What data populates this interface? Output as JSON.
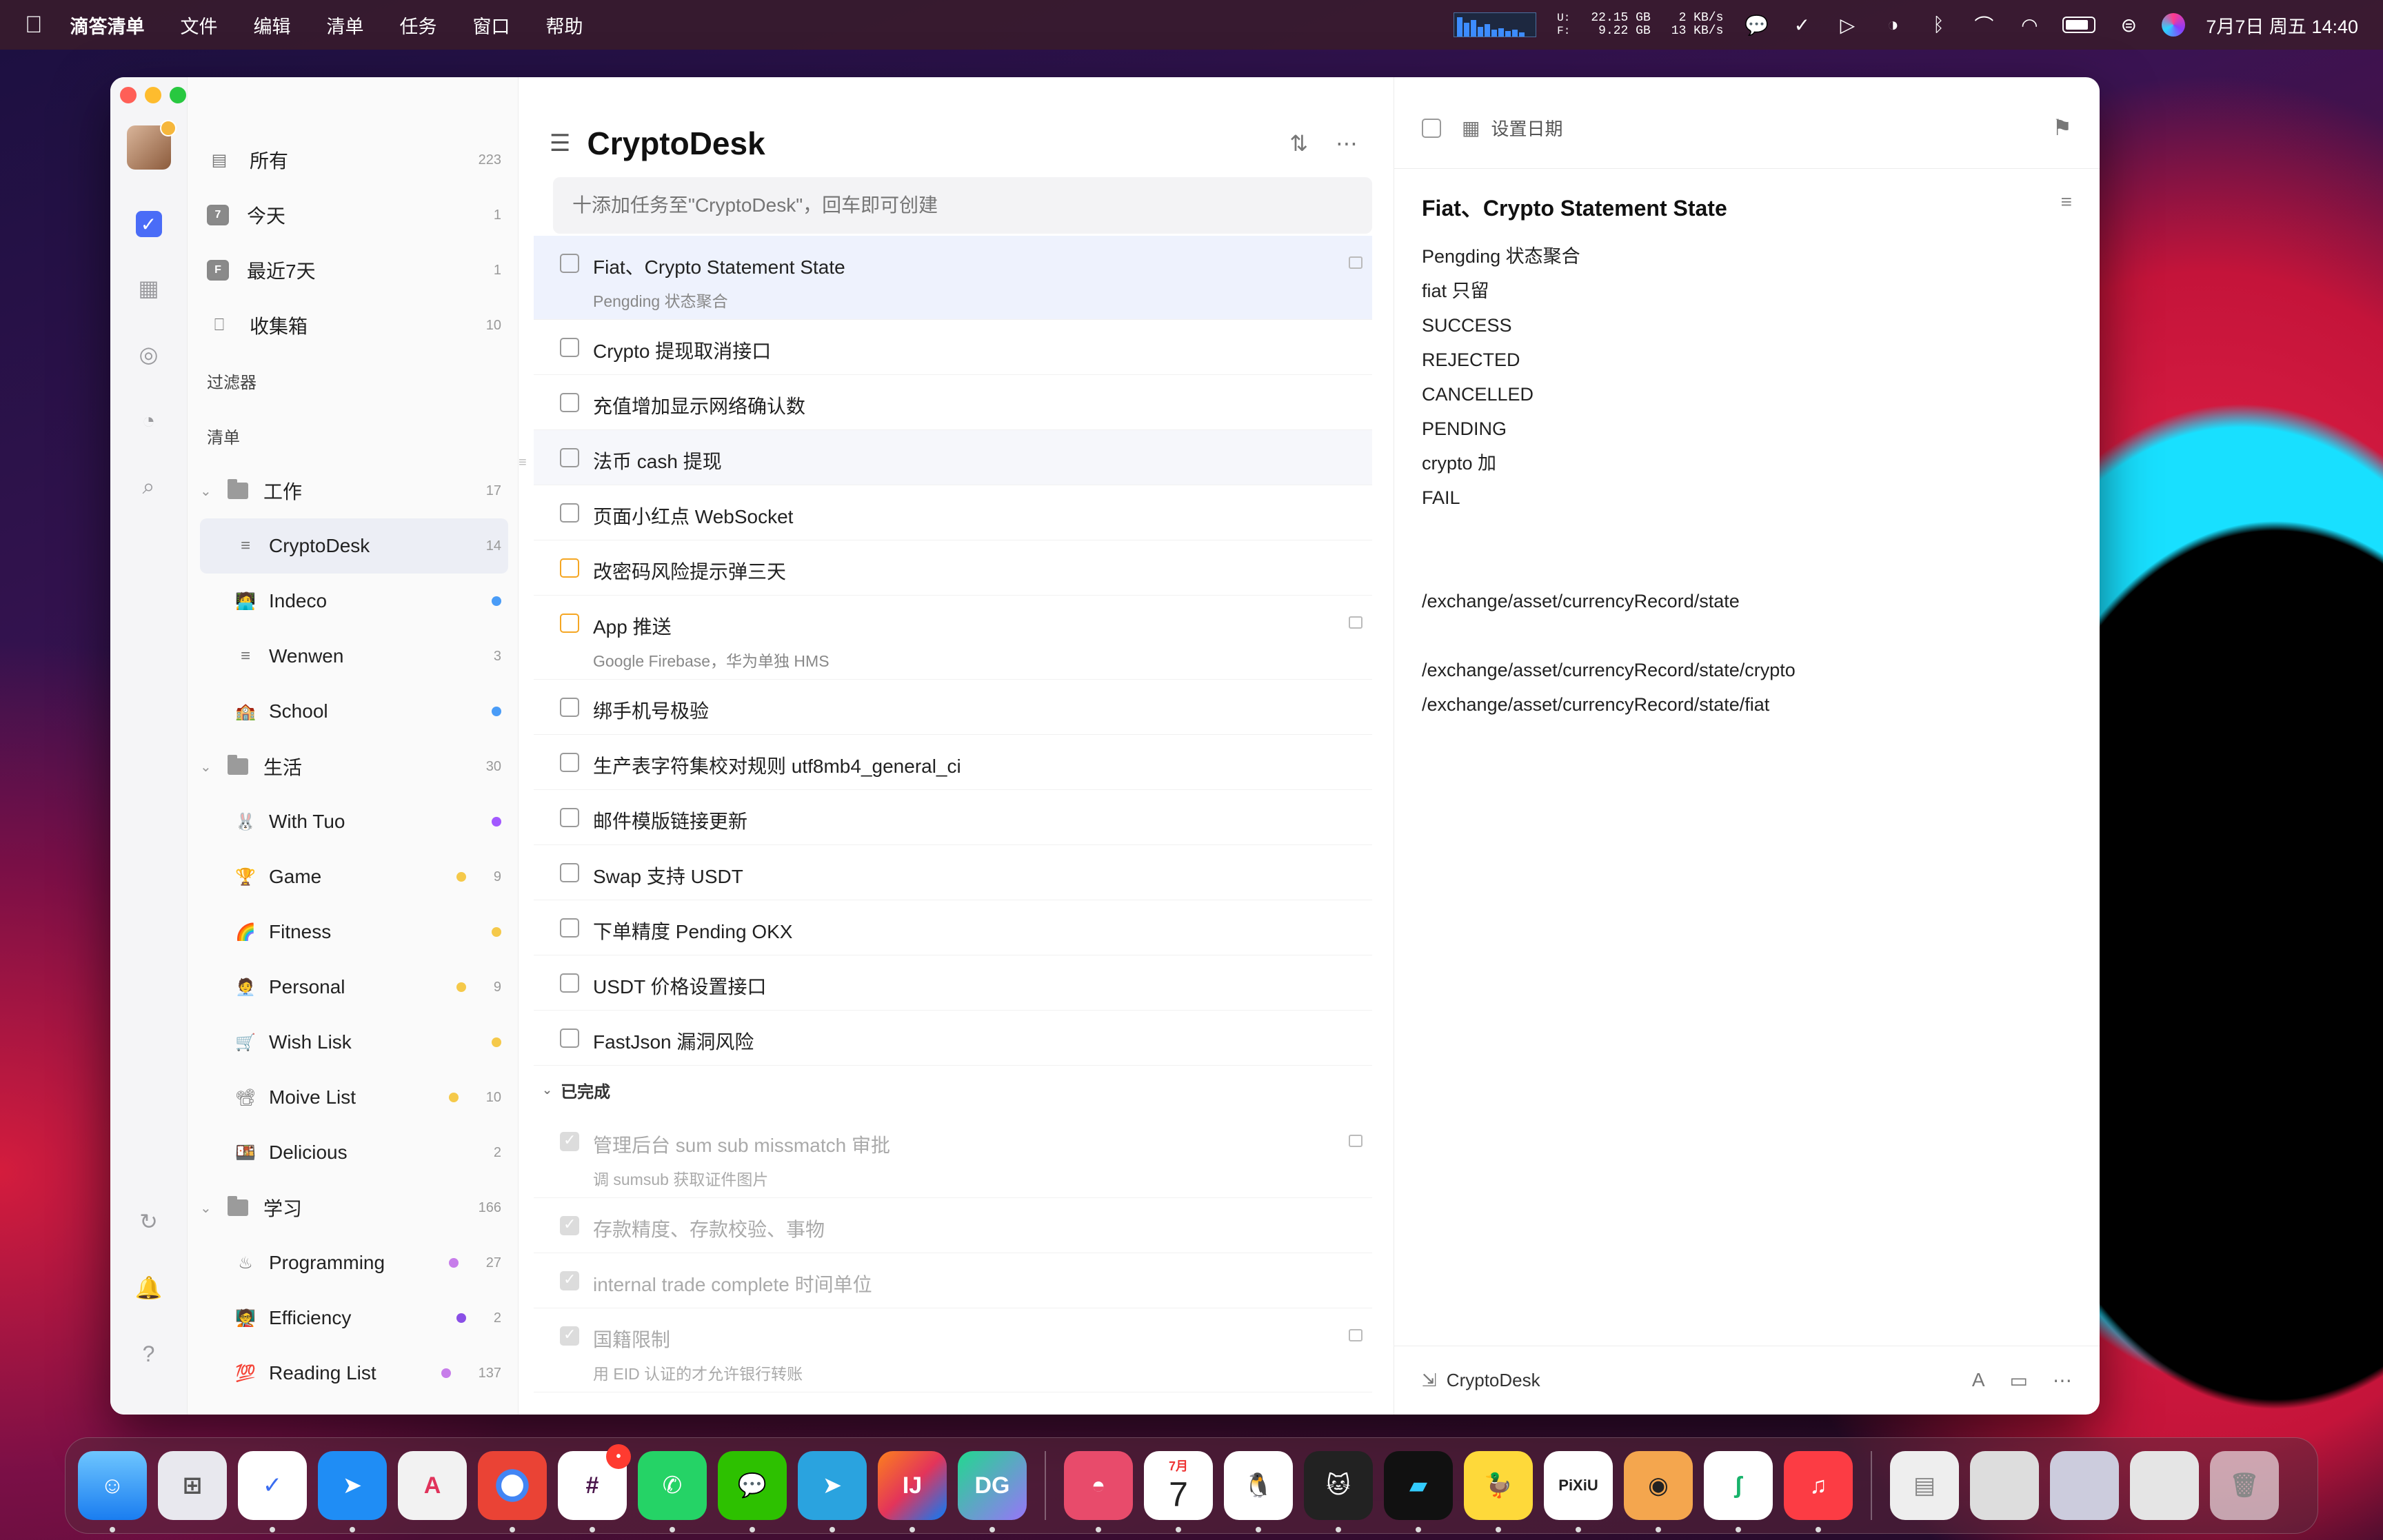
{
  "menubar": {
    "app_name": "滴答清单",
    "menus": [
      "文件",
      "编辑",
      "清单",
      "任务",
      "窗口",
      "帮助"
    ],
    "disk_labels": "U:\nF:",
    "disk_used": "22.15 GB",
    "disk_free": "9.22 GB",
    "net_up": "2 KB/s",
    "net_down": "13 KB/s",
    "datetime": "7月7日 周五  14:40"
  },
  "sidebar": {
    "smart_lists": [
      {
        "label": "所有",
        "count": "223"
      },
      {
        "label": "今天",
        "count": "1"
      },
      {
        "label": "最近7天",
        "count": "1"
      },
      {
        "label": "收集箱",
        "count": "10"
      }
    ],
    "filters_label": "过滤器",
    "lists_label": "清单",
    "folders": [
      {
        "label": "工作",
        "count": "17",
        "items": [
          {
            "label": "CryptoDesk",
            "count": "14",
            "icon": "≡"
          },
          {
            "label": "Indeco",
            "count": "",
            "icon": "🧑‍💻",
            "dot": "#4a9cf7"
          },
          {
            "label": "Wenwen",
            "count": "3",
            "icon": "≡"
          },
          {
            "label": "School",
            "count": "",
            "icon": "🏫",
            "dot": "#4a9cf7"
          }
        ]
      },
      {
        "label": "生活",
        "count": "30",
        "items": [
          {
            "label": "With Tuo",
            "count": "",
            "icon": "🐰",
            "dot": "#a259ff"
          },
          {
            "label": "Game",
            "count": "9",
            "icon": "🏆",
            "dot": "#f5c94a"
          },
          {
            "label": "Fitness",
            "count": "",
            "icon": "🌈",
            "dot": "#f5c94a"
          },
          {
            "label": "Personal",
            "count": "9",
            "icon": "🧑‍💼",
            "dot": "#f5c94a"
          },
          {
            "label": "Wish Lisk",
            "count": "",
            "icon": "🛒",
            "dot": "#f5c94a"
          },
          {
            "label": "Moive List",
            "count": "10",
            "icon": "📽",
            "dot": "#f5c94a"
          },
          {
            "label": "Delicious",
            "count": "2",
            "icon": "🍱"
          }
        ]
      },
      {
        "label": "学习",
        "count": "166",
        "items": [
          {
            "label": "Programming",
            "count": "27",
            "icon": "♨",
            "dot": "#c77dea"
          },
          {
            "label": "Efficiency",
            "count": "2",
            "icon": "🧑‍🏫",
            "dot": "#8a4fe6"
          },
          {
            "label": "Reading List",
            "count": "137",
            "icon": "💯",
            "dot": "#c77dea"
          }
        ]
      }
    ]
  },
  "tasklist": {
    "title": "CryptoDesk",
    "add_placeholder": "十添加任务至\"CryptoDesk\"，回车即可创建",
    "tasks": [
      {
        "text": "Fiat、Crypto Statement State",
        "sub": "Pengding 状态聚合",
        "note": true
      },
      {
        "text": "Crypto 提现取消接口",
        "sub": ""
      },
      {
        "text": "充值增加显示网络确认数",
        "sub": ""
      },
      {
        "text": "法币 cash 提现",
        "sub": ""
      },
      {
        "text": "页面小红点 WebSocket",
        "sub": ""
      },
      {
        "text": "改密码风险提示弹三天",
        "sub": "",
        "priority": true
      },
      {
        "text": "App 推送",
        "sub": "Google Firebase，华为单独 HMS",
        "priority": true,
        "note": true
      },
      {
        "text": "绑手机号极验",
        "sub": ""
      },
      {
        "text": "生产表字符集校对规则 utf8mb4_general_ci",
        "sub": ""
      },
      {
        "text": "邮件模版链接更新",
        "sub": ""
      },
      {
        "text": "Swap 支持 USDT",
        "sub": ""
      },
      {
        "text": "下单精度 Pending OKX",
        "sub": ""
      },
      {
        "text": "USDT 价格设置接口",
        "sub": ""
      },
      {
        "text": "FastJson 漏洞风险",
        "sub": ""
      }
    ],
    "completed_label": "已完成",
    "completed": [
      {
        "text": "管理后台 sum sub missmatch 审批",
        "sub": "调 sumsub 获取证件图片",
        "note": true
      },
      {
        "text": "存款精度、存款校验、事物",
        "sub": ""
      },
      {
        "text": "internal trade complete 时间单位",
        "sub": ""
      },
      {
        "text": "国籍限制",
        "sub": "用 EID 认证的才允许银行转账",
        "note": true
      }
    ]
  },
  "detail": {
    "date_label": "设置日期",
    "title": "Fiat、Crypto Statement State",
    "lines": [
      "Pengding 状态聚合",
      "fiat 只留",
      "SUCCESS",
      "REJECTED",
      "CANCELLED",
      "PENDING",
      "crypto 加",
      "FAIL",
      "",
      "",
      "/exchange/asset/currencyRecord/state",
      "",
      "/exchange/asset/currencyRecord/state/crypto",
      "/exchange/asset/currencyRecord/state/fiat"
    ],
    "project": "CryptoDesk"
  },
  "dock": {
    "calendar_month": "7月",
    "calendar_day": "7",
    "slack_badge": "•"
  }
}
